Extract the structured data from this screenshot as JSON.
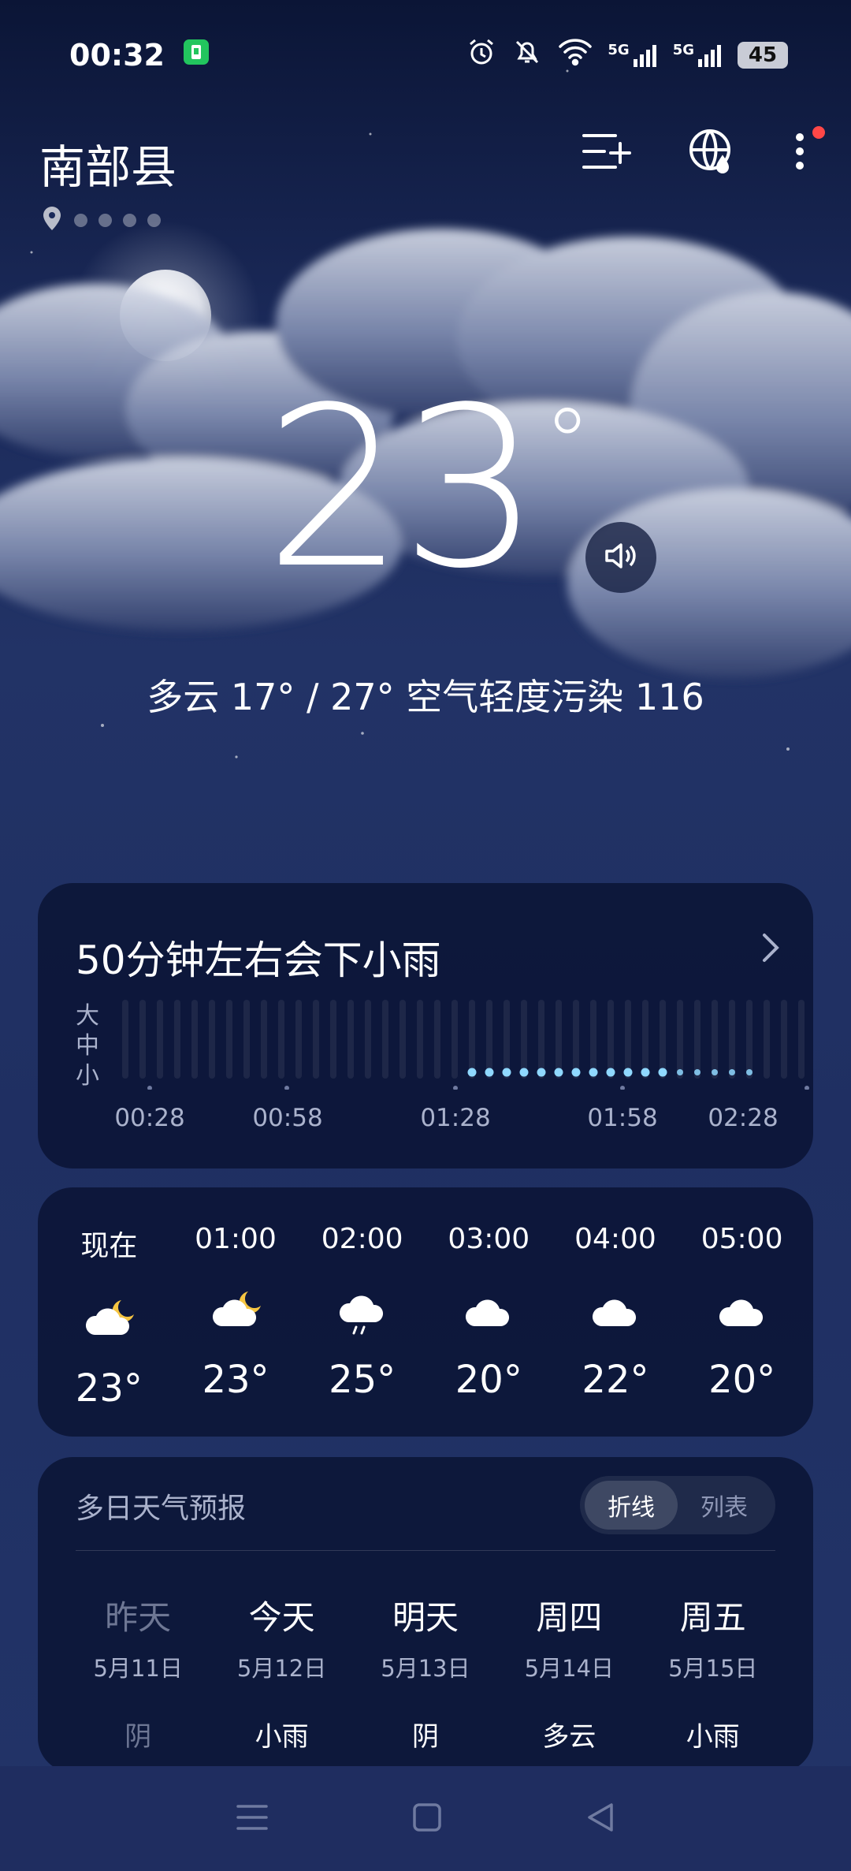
{
  "status_bar": {
    "time": "00:32",
    "network_left": "5G",
    "network_right": "5G",
    "battery": "45"
  },
  "header": {
    "city": "南部县",
    "page_indicator_count": 5
  },
  "current": {
    "temperature": "23",
    "degree_symbol": "°",
    "summary": "多云  17° / 27°  空气轻度污染 116"
  },
  "rain_card": {
    "title": "50分钟左右会下小雨",
    "levels": [
      "大",
      "中",
      "小"
    ],
    "time_labels": [
      "00:28",
      "00:58",
      "01:28",
      "01:58",
      "02:28"
    ],
    "intensity": [
      0,
      0,
      0,
      0,
      0,
      0,
      0,
      0,
      0,
      0,
      0,
      0,
      0,
      0,
      0,
      0,
      0,
      0,
      0,
      0,
      1,
      1,
      1,
      1,
      1,
      1,
      1,
      1,
      1,
      1,
      1,
      1,
      0.6,
      0.6,
      0.6,
      0.6,
      0.6,
      0,
      0,
      0
    ]
  },
  "hourly": [
    {
      "time": "现在",
      "icon": "cloudy-night-icon",
      "temp": "23°"
    },
    {
      "time": "01:00",
      "icon": "cloudy-night-icon",
      "temp": "23°"
    },
    {
      "time": "02:00",
      "icon": "light-rain-icon",
      "temp": "25°"
    },
    {
      "time": "03:00",
      "icon": "cloud-icon",
      "temp": "20°"
    },
    {
      "time": "04:00",
      "icon": "cloud-icon",
      "temp": "22°"
    },
    {
      "time": "05:00",
      "icon": "cloud-icon",
      "temp": "20°"
    }
  ],
  "forecast": {
    "title": "多日天气预报",
    "toggle": {
      "active": "折线",
      "inactive": "列表"
    },
    "days": [
      {
        "name": "昨天",
        "date": "5月11日",
        "cond": "阴"
      },
      {
        "name": "今天",
        "date": "5月12日",
        "cond": "小雨"
      },
      {
        "name": "明天",
        "date": "5月13日",
        "cond": "阴"
      },
      {
        "name": "周四",
        "date": "5月14日",
        "cond": "多云"
      },
      {
        "name": "周五",
        "date": "5月15日",
        "cond": "小雨"
      }
    ]
  },
  "colors": {
    "accent_rain": "#8fd8ff",
    "card_bg": "#0b1434",
    "moon": "#f5c542",
    "notif_dot": "#ff4747"
  }
}
